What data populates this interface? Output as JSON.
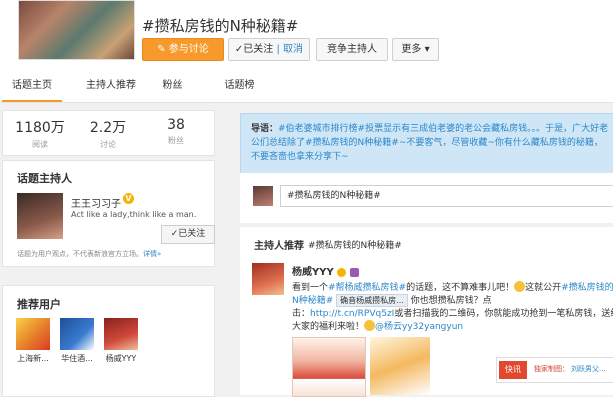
{
  "header": {
    "title": "#攒私房钱的N种秘籍#",
    "join_button": "参与讨论",
    "follow_button": "✓已关注",
    "cancel_link": "取消",
    "host_button": "竞争主持人",
    "more_button": "更多",
    "accent_color": "#f79a2b"
  },
  "tabs": [
    "话题主页",
    "主持人推荐",
    "粉丝",
    "话题榜"
  ],
  "stats": [
    {
      "value": "1180万",
      "label": "阅读"
    },
    {
      "value": "2.2万",
      "label": "讨论"
    },
    {
      "value": "38",
      "label": "粉丝"
    }
  ],
  "host": {
    "heading": "话题主持人",
    "name": "王王习习子",
    "verified_icon": "V",
    "description": "Act like a lady,think like a man.",
    "follow_button": "✓已关注",
    "note": "话题为用户观点，不代表新浪官方立场。",
    "note_link": "详情»"
  },
  "recommended": {
    "heading": "推荐用户",
    "users": [
      {
        "name": "上海新..."
      },
      {
        "name": "华住酒..."
      },
      {
        "name": "杨威YYY"
      }
    ]
  },
  "guide": {
    "label": "导语：",
    "text": "#伯老婆城市排行榜#投票显示有三成伯老婆的老公会藏私房钱。。。于是，广大好老公们总结除了#攒私房钱的N种秘籍#~不要客气，尽管收藏~你有什么藏私房钱的秘籍，不要吝啬也拿来分享下~"
  },
  "post": {
    "input_value": "#攒私房钱的N种秘籍#"
  },
  "host_rec": {
    "title": "主持人推荐",
    "tag": "#攒私房钱的N种秘籍#",
    "user": "杨威YYY",
    "line1_a": "看到一个",
    "line1_link": "#帮杨威攒私房钱#",
    "line1_b": "的话题，这不算难事儿吧！",
    "line1_c": "这就公开",
    "line1_link2": "#攒私房钱的",
    "line2_link": "N种秘籍#",
    "line2_chip": "确音杨威攒私房...",
    "line2_b": "你也想攒私房钱？点",
    "line3_a": "击：",
    "line3_link": "http://t.cn/RPVq5zI",
    "line3_b": "或者扫描我的二维码，你就能成功抢到一笔私房钱，送给",
    "line4_a": "大家的福利来啦！",
    "line4_link": "@杨云yy32yangyun"
  },
  "popup": {
    "badge": "快讯",
    "source": "独家制图：",
    "link": "刘跃男父..."
  }
}
